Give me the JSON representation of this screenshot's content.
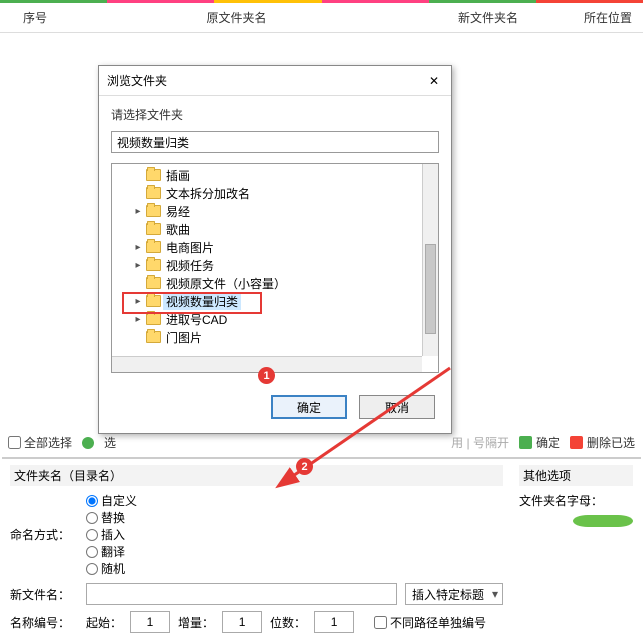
{
  "headers": {
    "idx": "序号",
    "old": "原文件夹名",
    "new": "新文件夹名",
    "loc": "所在位置"
  },
  "dialog": {
    "title": "浏览文件夹",
    "sub": "请选择文件夹",
    "input_value": "视频数量归类",
    "ok": "确定",
    "cancel": "取消",
    "tree": [
      {
        "tw": "",
        "label": "插画"
      },
      {
        "tw": "",
        "label": "文本拆分加改名"
      },
      {
        "tw": "▸",
        "label": "易经"
      },
      {
        "tw": "",
        "label": "歌曲"
      },
      {
        "tw": "▸",
        "label": "电商图片"
      },
      {
        "tw": "▸",
        "label": "视频任务"
      },
      {
        "tw": "",
        "label": "视频原文件（小容量）"
      },
      {
        "tw": "▸",
        "label": "视频数量归类",
        "sel": true
      },
      {
        "tw": "▸",
        "label": "进取号CAD"
      },
      {
        "tw": "",
        "label": "门图片"
      }
    ]
  },
  "markers": {
    "m1": "1",
    "m2": "2"
  },
  "controls": {
    "select_all": "全部选择",
    "sel_hint": "选",
    "ghost": "用 | 号隔开",
    "confirm": "确定",
    "remove": "删除已选"
  },
  "panel": {
    "left_title": "文件夹名（目录名）",
    "right_title": "其他选项",
    "naming_label": "命名方式：",
    "naming_opts": [
      "自定义",
      "替换",
      "插入",
      "翻译",
      "随机"
    ],
    "newname_label": "新文件名：",
    "insert_drop": "插入特定标题",
    "seq_label": "名称编号：",
    "start_l": "起始：",
    "start_v": "1",
    "step_l": "增量：",
    "step_v": "1",
    "digits_l": "位数：",
    "digits_v": "1",
    "diffpath": "不同路径单独编号",
    "right_field": "文件夹名字母："
  }
}
